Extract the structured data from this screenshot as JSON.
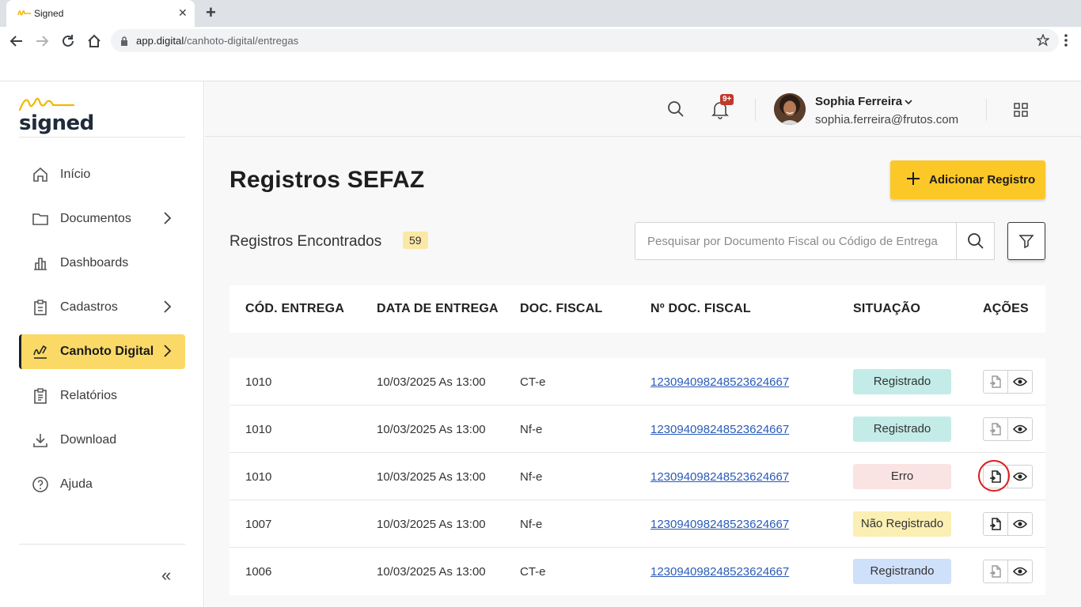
{
  "browser": {
    "tab_title": "Signed",
    "url_host": "app.digital",
    "url_path": "/canhoto-digital/entregas"
  },
  "sidebar": {
    "logo_text": "signed",
    "items": [
      {
        "label": "Início",
        "icon": "home-icon",
        "has_chevron": false,
        "active": false
      },
      {
        "label": "Documentos",
        "icon": "folder-icon",
        "has_chevron": true,
        "active": false
      },
      {
        "label": "Dashboards",
        "icon": "bar-chart-icon",
        "has_chevron": false,
        "active": false
      },
      {
        "label": "Cadastros",
        "icon": "clipboard-icon",
        "has_chevron": true,
        "active": false
      },
      {
        "label": "Canhoto Digital",
        "icon": "signature-icon",
        "has_chevron": true,
        "active": true
      },
      {
        "label": "Relatórios",
        "icon": "report-icon",
        "has_chevron": false,
        "active": false
      },
      {
        "label": "Download",
        "icon": "download-icon",
        "has_chevron": false,
        "active": false
      },
      {
        "label": "Ajuda",
        "icon": "help-icon",
        "has_chevron": false,
        "active": false
      }
    ],
    "collapse_label": "«"
  },
  "header": {
    "notification_badge": "9+",
    "user_name": "Sophia Ferreira",
    "user_email": "sophia.ferreira@frutos.com"
  },
  "page": {
    "title": "Registros SEFAZ",
    "add_button_label": "Adicionar Registro",
    "found_label": "Registros Encontrados",
    "found_count": "59",
    "search_placeholder": "Pesquisar por Documento Fiscal ou Código de Entrega"
  },
  "table": {
    "headers": [
      "CÓD. ENTREGA",
      "DATA DE ENTREGA",
      "DOC. FISCAL",
      "Nº DOC. FISCAL",
      "SITUAÇÃO",
      "AÇÕES"
    ],
    "rows": [
      {
        "code": "1010",
        "date": "10/03/2025 As 13:00",
        "doc": "CT-e",
        "number": "1230940982485236246​67",
        "status": "Registrado",
        "status_kind": "registrado"
      },
      {
        "code": "1010",
        "date": "10/03/2025 As 13:00",
        "doc": "Nf-e",
        "number": "123094098248523624667",
        "status": "Registrado",
        "status_kind": "registrado"
      },
      {
        "code": "1010",
        "date": "10/03/2025 As 13:00",
        "doc": "Nf-e",
        "number": "123094098248523624667",
        "status": "Erro",
        "status_kind": "erro"
      },
      {
        "code": "1007",
        "date": "10/03/2025 As 13:00",
        "doc": "Nf-e",
        "number": "123094098248523624667",
        "status": "Não Registrado",
        "status_kind": "nao"
      },
      {
        "code": "1006",
        "date": "10/03/2025 As 13:00",
        "doc": "CT-e",
        "number": "123094098248523624667",
        "status": "Registrando",
        "status_kind": "registrando"
      }
    ]
  },
  "colors": {
    "accent": "#fbc827",
    "active_nav": "#fbd967",
    "highlight_ring": "#e01a1a"
  }
}
